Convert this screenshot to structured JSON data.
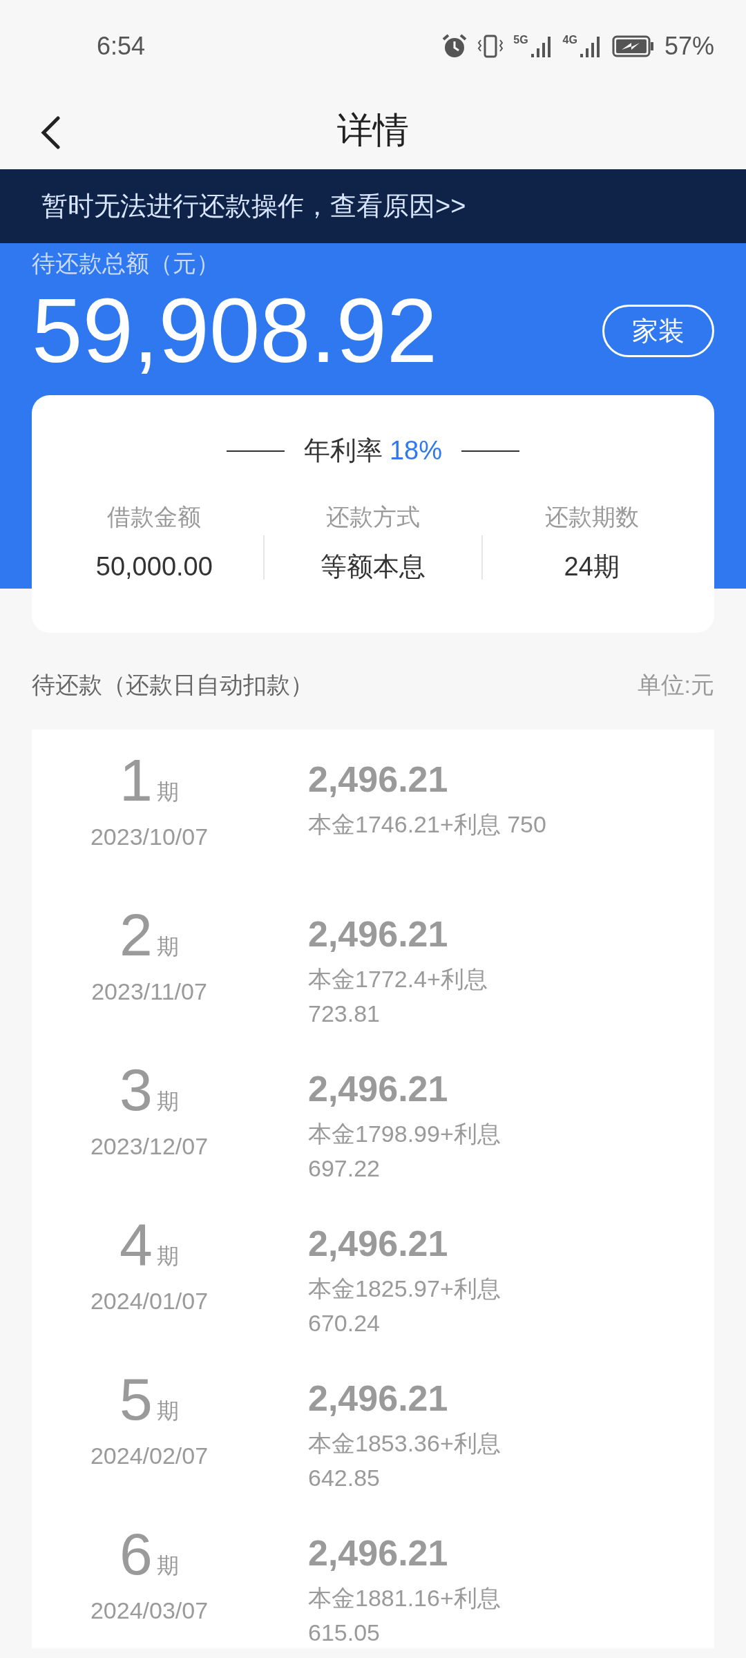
{
  "status_bar": {
    "time": "6:54",
    "networks": [
      "5G",
      "4G"
    ],
    "battery": "57%"
  },
  "header": {
    "title": "详情"
  },
  "notice": {
    "text": "暂时无法进行还款操作，查看原因>>"
  },
  "summary": {
    "label": "待还款总额（元）",
    "amount": "59,908.92",
    "tag": "家装"
  },
  "loan_card": {
    "rate_label": "年利率",
    "rate": "18%",
    "stats": [
      {
        "label": "借款金额",
        "value": "50,000.00"
      },
      {
        "label": "还款方式",
        "value": "等额本息"
      },
      {
        "label": "还款期数",
        "value": "24期"
      }
    ]
  },
  "schedule": {
    "title": "待还款（还款日自动扣款）",
    "unit": "单位:元",
    "rows": [
      {
        "period": "1",
        "period_unit": "期",
        "date": "2023/10/07",
        "amount": "2,496.21",
        "detail": "本金1746.21+利息 750"
      },
      {
        "period": "2",
        "period_unit": "期",
        "date": "2023/11/07",
        "amount": "2,496.21",
        "detail": "本金1772.4+利息723.81"
      },
      {
        "period": "3",
        "period_unit": "期",
        "date": "2023/12/07",
        "amount": "2,496.21",
        "detail": "本金1798.99+利息697.22"
      },
      {
        "period": "4",
        "period_unit": "期",
        "date": "2024/01/07",
        "amount": "2,496.21",
        "detail": "本金1825.97+利息670.24"
      },
      {
        "period": "5",
        "period_unit": "期",
        "date": "2024/02/07",
        "amount": "2,496.21",
        "detail": "本金1853.36+利息642.85"
      },
      {
        "period": "6",
        "period_unit": "期",
        "date": "2024/03/07",
        "amount": "2,496.21",
        "detail": "本金1881.16+利息615.05"
      }
    ]
  }
}
